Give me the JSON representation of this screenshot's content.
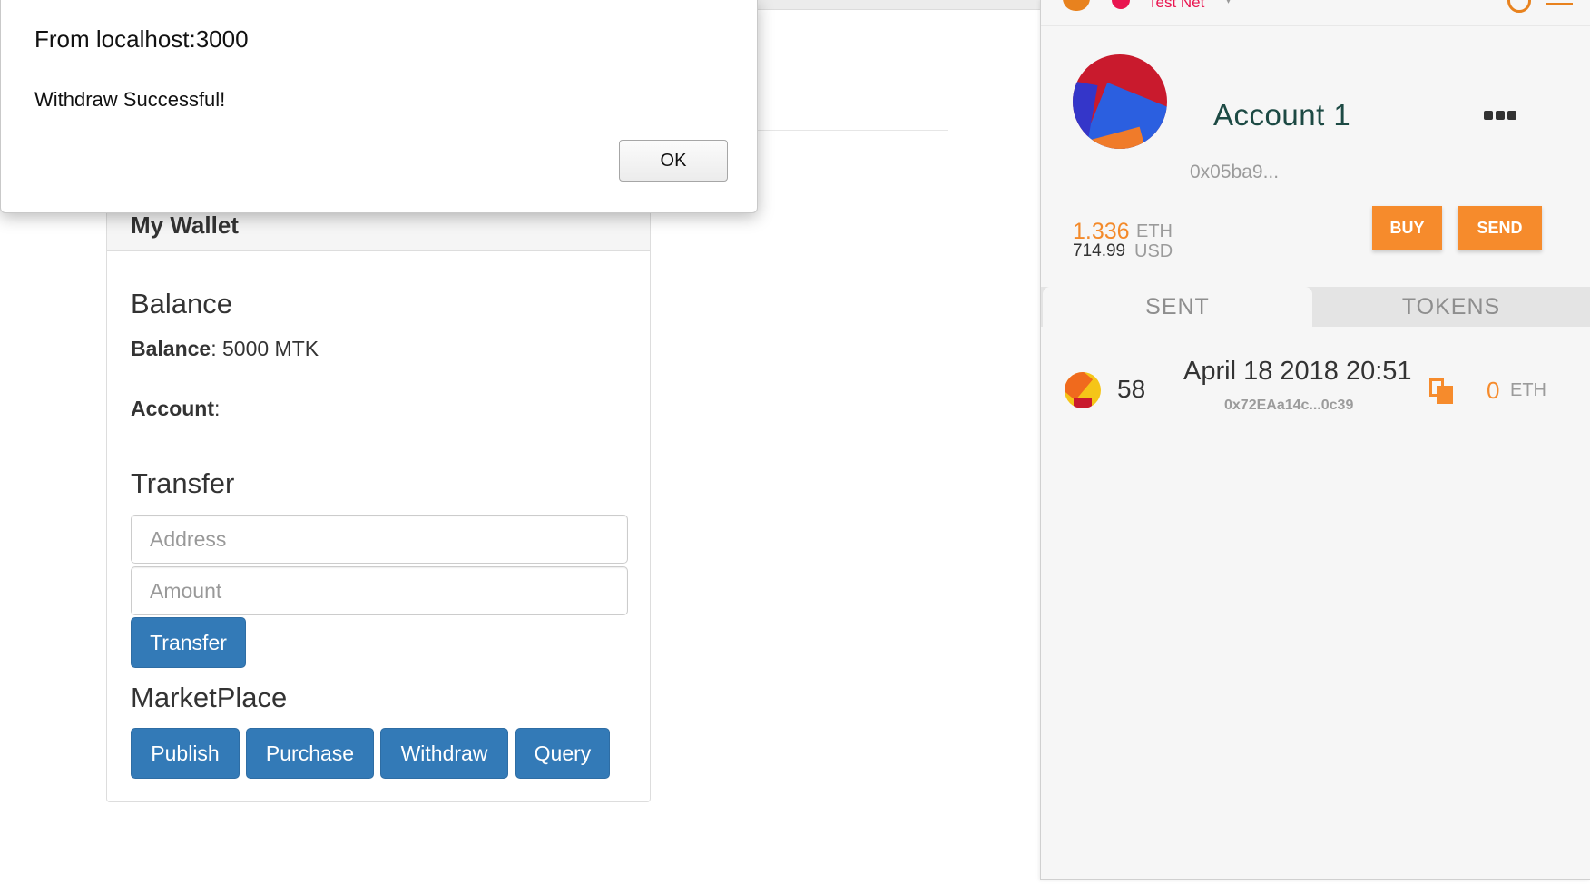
{
  "dialog": {
    "title": "From localhost:3000",
    "message": "Withdraw Successful!",
    "ok_label": "OK"
  },
  "wallet": {
    "panel_title": "My Wallet",
    "balance_heading": "Balance",
    "balance_label": "Balance",
    "balance_value": ": 5000 MTK",
    "account_label": "Account",
    "account_value": ":",
    "transfer_heading": "Transfer",
    "address_placeholder": "Address",
    "amount_placeholder": "Amount",
    "transfer_button": "Transfer",
    "marketplace_heading": "MarketPlace",
    "buttons": {
      "publish": "Publish",
      "purchase": "Purchase",
      "withdraw": "Withdraw",
      "query": "Query"
    },
    "button_color": "#337ab7"
  },
  "metamask": {
    "network": "Test Net",
    "network_color": "#e91550",
    "account_name": "Account 1",
    "address": "0x05ba9...",
    "eth_balance": "1.336",
    "eth_unit": "ETH",
    "usd_balance": "714.99",
    "usd_unit": "USD",
    "buy_label": "BUY",
    "send_label": "SEND",
    "accent_color": "#f68b2c",
    "tabs": [
      "SENT",
      "TOKENS"
    ],
    "transactions": [
      {
        "nonce": "58",
        "date": "April 18 2018 20:51",
        "to": "0x72EAa14c...0c39",
        "value": "0",
        "unit": "ETH"
      }
    ],
    "icons": [
      "fox-logo-icon",
      "network-dot-icon",
      "sync-icon",
      "hamburger-menu-icon",
      "identicon",
      "more-icon",
      "copy-icon"
    ]
  }
}
